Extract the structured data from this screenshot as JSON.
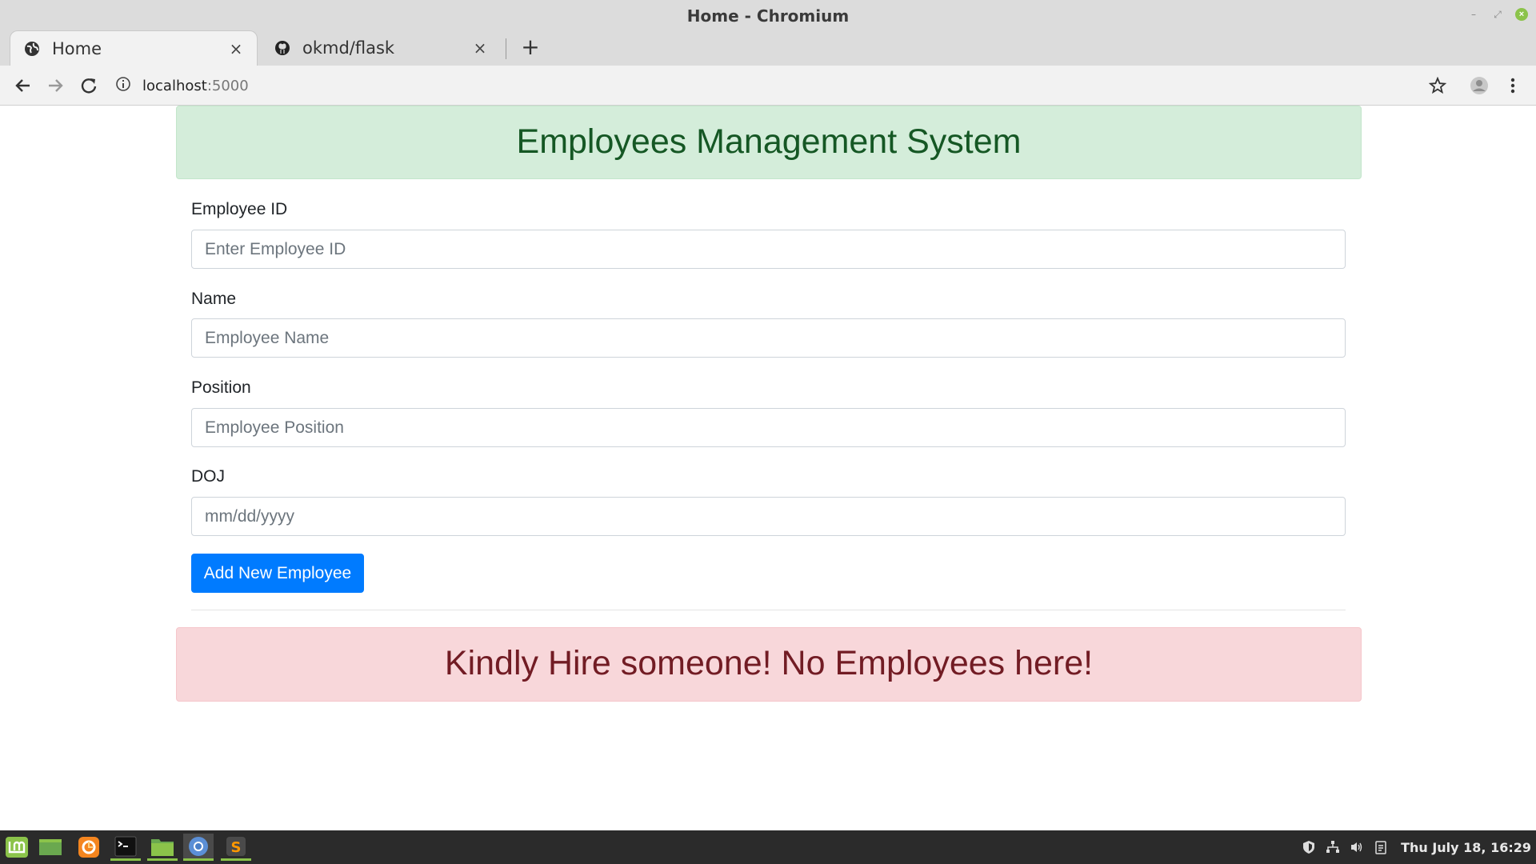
{
  "window": {
    "title": "Home - Chromium",
    "minimize_glyph": "–",
    "restore_glyph": "⤢",
    "close_glyph": "×"
  },
  "tabs": [
    {
      "label": "Home",
      "icon": "globe-icon",
      "close": "×"
    },
    {
      "label": "okmd/flask",
      "icon": "github-icon",
      "close": "×"
    }
  ],
  "new_tab_glyph": "+",
  "address_bar": {
    "host": "localhost",
    "port": ":5000"
  },
  "page": {
    "header": "Employees Management System",
    "fields": [
      {
        "label": "Employee ID",
        "placeholder": "Enter Employee ID"
      },
      {
        "label": "Name",
        "placeholder": "Employee Name"
      },
      {
        "label": "Position",
        "placeholder": "Employee Position"
      },
      {
        "label": "DOJ",
        "placeholder": "mm/dd/yyyy"
      }
    ],
    "submit_label": "Add New Employee",
    "empty_message": "Kindly Hire someone! No Employees here!"
  },
  "taskbar": {
    "apps": [
      "mint-menu-icon",
      "show-desktop-icon",
      "firefox-icon",
      "terminal-icon",
      "files-icon",
      "chromium-icon",
      "sublime-text-icon"
    ],
    "clock": "Thu July 18, 16:29"
  },
  "colors": {
    "success_bg": "#d4edda",
    "success_text": "#155724",
    "danger_bg": "#f8d7da",
    "danger_text": "#721c24",
    "primary": "#007bff",
    "mint_green": "#8bc34a"
  }
}
